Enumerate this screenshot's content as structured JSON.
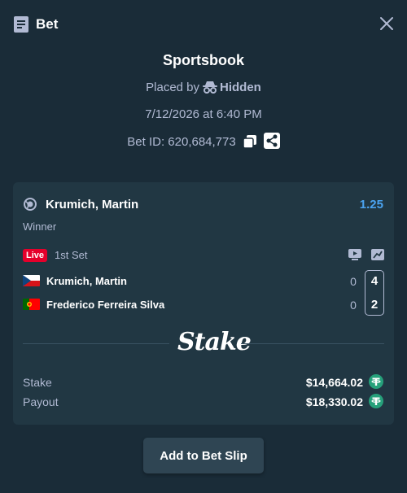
{
  "header": {
    "title": "Bet",
    "title_icon": "receipt-icon",
    "close_icon": "close-icon"
  },
  "summary": {
    "title": "Sportsbook",
    "placed_by_prefix": "Placed by",
    "placed_by_user": "Hidden",
    "date": "7/12/2026 at 6:40 PM",
    "bet_id_label": "Bet ID: 620,684,773"
  },
  "bet": {
    "selection": "Krumich, Martin",
    "odds": "1.25",
    "market": "Winner",
    "live_label": "Live",
    "set_label": "1st Set",
    "players": [
      {
        "name": "Krumich, Martin",
        "games": "0",
        "sets": "4",
        "flag": "czech-flag"
      },
      {
        "name": "Frederico Ferreira Silva",
        "games": "0",
        "sets": "2",
        "flag": "portugal-flag"
      }
    ],
    "logo_text": "Stake",
    "stake_label": "Stake",
    "stake_value": "$14,664.02",
    "payout_label": "Payout",
    "payout_value": "$18,330.02",
    "currency_icon": "tether-icon"
  },
  "actions": {
    "add_to_slip": "Add to Bet Slip"
  },
  "colors": {
    "background": "#1a2c38",
    "card": "#213743",
    "odds": "#4ba3f0",
    "live": "#e5002b",
    "tether": "#26a17b"
  }
}
